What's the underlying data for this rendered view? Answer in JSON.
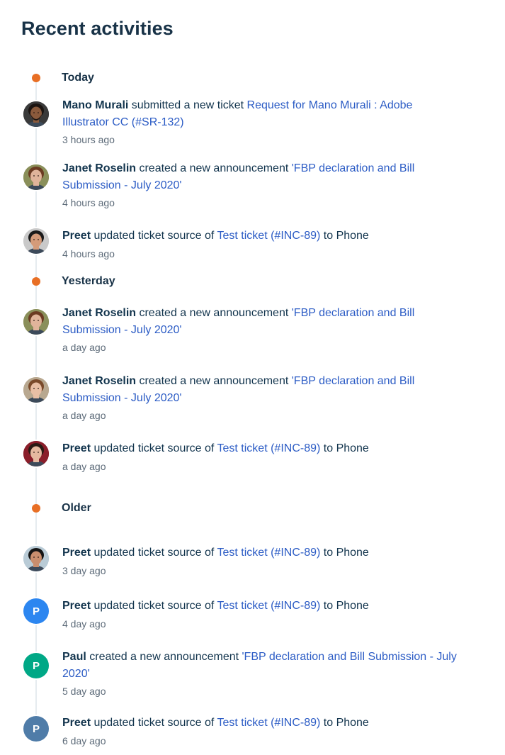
{
  "page": {
    "title": "Recent activities"
  },
  "groups": [
    {
      "label": "Today"
    },
    {
      "label": "Yesterday"
    },
    {
      "label": "Older"
    }
  ],
  "activities": [
    {
      "actor": "Mano Murali",
      "action": " submitted a new ticket ",
      "link": "Request for Mano Murali : Adobe Illustrator CC (#SR-132)",
      "suffix": "",
      "time": "3 hours ago",
      "avatar": {
        "type": "photo",
        "skin": "#8a5a3c",
        "hair": "#1b1411",
        "bg": "#3a3a3a",
        "beard": true
      }
    },
    {
      "actor": "Janet Roselin",
      "action": " created a new announcement ",
      "link": "'FBP declaration and Bill Submission - July 2020'",
      "suffix": "",
      "time": "4 hours ago",
      "avatar": {
        "type": "photo",
        "skin": "#e0b49a",
        "hair": "#6b3b22",
        "bg": "#8a8f5a",
        "beard": false
      }
    },
    {
      "actor": "Preet",
      "action": " updated ticket source of ",
      "link": "Test ticket (#INC-89)",
      "suffix": " to Phone",
      "time": "4 hours ago",
      "avatar": {
        "type": "photo",
        "skin": "#d49b7a",
        "hair": "#1a1a1a",
        "bg": "#c9c9c9",
        "beard": false
      }
    },
    {
      "actor": "Janet Roselin",
      "action": " created a new announcement ",
      "link": "'FBP declaration and Bill Submission - July 2020'",
      "suffix": "",
      "time": "a day ago",
      "avatar": {
        "type": "photo",
        "skin": "#e0b49a",
        "hair": "#6b3b22",
        "bg": "#8a8f5a",
        "beard": false
      }
    },
    {
      "actor": "Janet Roselin",
      "action": " created a new announcement ",
      "link": "'FBP declaration and Bill Submission - July 2020'",
      "suffix": "",
      "time": "a day ago",
      "avatar": {
        "type": "photo",
        "skin": "#e8bfa5",
        "hair": "#7a4a2a",
        "bg": "#b8a890",
        "beard": false
      }
    },
    {
      "actor": "Preet",
      "action": " updated ticket source of ",
      "link": "Test ticket (#INC-89)",
      "suffix": " to Phone",
      "time": "a day ago",
      "avatar": {
        "type": "photo",
        "skin": "#e6b9a0",
        "hair": "#2a1a14",
        "bg": "#8a1e2a",
        "beard": false
      }
    },
    {
      "actor": "Preet",
      "action": " updated ticket source of ",
      "link": "Test ticket (#INC-89)",
      "suffix": " to Phone",
      "time": "3 day ago",
      "avatar": {
        "type": "photo",
        "skin": "#c98e6e",
        "hair": "#151515",
        "bg": "#b9cbd6",
        "beard": false
      }
    },
    {
      "actor": "Preet",
      "action": " updated ticket source of ",
      "link": "Test ticket (#INC-89)",
      "suffix": " to Phone",
      "time": "4 day ago",
      "avatar": {
        "type": "initial",
        "initial": "P",
        "bg": "#2c86f0"
      }
    },
    {
      "actor": "Paul",
      "action": " created a new announcement ",
      "link": "'FBP declaration and Bill Submission - July 2020'",
      "suffix": "",
      "time": "5 day ago",
      "avatar": {
        "type": "initial",
        "initial": "P",
        "bg": "#00a886"
      }
    },
    {
      "actor": "Preet",
      "action": " updated ticket source of ",
      "link": "Test ticket (#INC-89)",
      "suffix": " to Phone",
      "time": "6 day ago",
      "avatar": {
        "type": "initial",
        "initial": "P",
        "bg": "#4f7ca8"
      }
    }
  ]
}
